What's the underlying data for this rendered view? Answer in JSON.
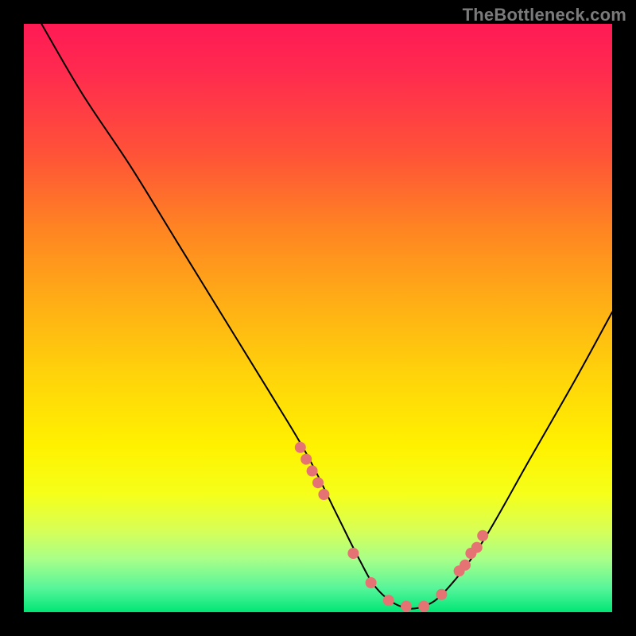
{
  "watermark": "TheBottleneck.com",
  "chart_data": {
    "type": "line",
    "title": "",
    "xlabel": "",
    "ylabel": "",
    "xlim": [
      0,
      100
    ],
    "ylim": [
      0,
      100
    ],
    "series": [
      {
        "name": "bottleneck-curve",
        "x": [
          3,
          10,
          18,
          26,
          34,
          42,
          48,
          53,
          57,
          60,
          64,
          68,
          72,
          78,
          86,
          94,
          100
        ],
        "y": [
          100,
          88,
          76,
          63,
          50,
          37,
          27,
          17,
          9,
          4,
          1,
          1,
          4,
          12,
          26,
          40,
          51
        ]
      }
    ],
    "marker_points": {
      "name": "highlight-dots",
      "x": [
        47,
        48,
        49,
        50,
        51,
        56,
        59,
        62,
        65,
        68,
        71,
        74,
        75,
        76,
        77,
        78
      ],
      "y": [
        28,
        26,
        24,
        22,
        20,
        10,
        5,
        2,
        1,
        1,
        3,
        7,
        8,
        10,
        11,
        13
      ]
    }
  },
  "colors": {
    "curve": "#000000",
    "dot": "#e57373",
    "gradient_top": "#ff1a55",
    "gradient_bottom": "#00e676"
  }
}
